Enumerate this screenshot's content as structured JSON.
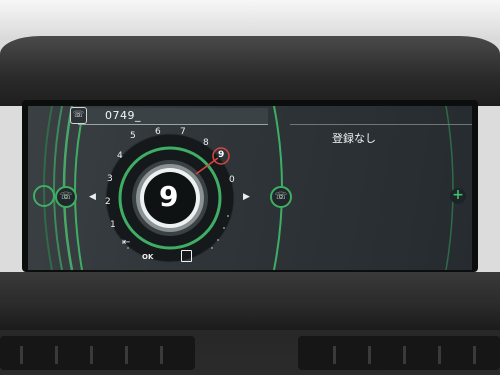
{
  "input": {
    "value": "0749_"
  },
  "list": {
    "empty_text": "登録なし"
  },
  "speller": {
    "selected_digit": "9",
    "highlighted_digit": "9",
    "digits": [
      "5",
      "6",
      "7",
      "8",
      "9",
      "0",
      "1",
      "2",
      "3",
      "4"
    ],
    "ok_label": "OK",
    "backspace_label": "⇤"
  },
  "colors": {
    "accent_green": "#3fae64",
    "highlight_red": "#d8473f"
  },
  "icons": {
    "header": "phone-book-icon",
    "add": "plus-icon",
    "left": "triangle-left-icon",
    "right": "triangle-right-icon",
    "copy": "copy-icon"
  }
}
